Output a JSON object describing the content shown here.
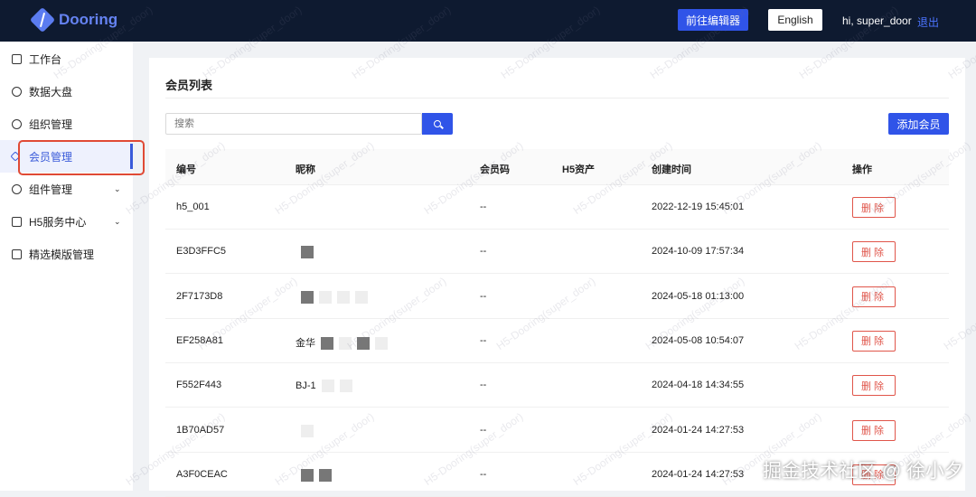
{
  "header": {
    "logo": "Dooring",
    "editor_button": "前往编辑器",
    "lang_button": "English",
    "user": "hi, super_door",
    "logout": "退出"
  },
  "sidebar": {
    "items": [
      {
        "label": "工作台"
      },
      {
        "label": "数据大盘"
      },
      {
        "label": "组织管理"
      },
      {
        "label": "会员管理",
        "active": true
      },
      {
        "label": "组件管理",
        "expandable": true
      },
      {
        "label": "H5服务中心",
        "expandable": true
      },
      {
        "label": "精选模版管理"
      }
    ]
  },
  "main": {
    "title": "会员列表",
    "search_placeholder": "搜索",
    "add_button": "添加会员",
    "columns": [
      "编号",
      "昵称",
      "会员码",
      "H5资产",
      "创建时间",
      "操作"
    ],
    "rows": [
      {
        "id": "h5_001",
        "nickname": "",
        "code": "--",
        "assets": "",
        "created": "2022-12-19 15:45:01",
        "action": "删除"
      },
      {
        "id": "E3D3FFC5",
        "nickname": "",
        "code": "--",
        "assets": "",
        "created": "2024-10-09 17:57:34",
        "action": "删除"
      },
      {
        "id": "2F7173D8",
        "nickname": "",
        "code": "--",
        "assets": "",
        "created": "2024-05-18 01:13:00",
        "action": "删除"
      },
      {
        "id": "EF258A81",
        "nickname": "金华",
        "code": "--",
        "assets": "",
        "created": "2024-05-08 10:54:07",
        "action": "删除"
      },
      {
        "id": "F552F443",
        "nickname": "BJ-1",
        "code": "--",
        "assets": "",
        "created": "2024-04-18 14:34:55",
        "action": "删除"
      },
      {
        "id": "1B70AD57",
        "nickname": "",
        "code": "--",
        "assets": "",
        "created": "2024-01-24 14:27:53",
        "action": "删除"
      },
      {
        "id": "A3F0CEAC",
        "nickname": "",
        "code": "--",
        "assets": "",
        "created": "2024-01-24 14:27:53",
        "action": "删除"
      }
    ]
  },
  "watermark": "H5-Dooring(super_door)",
  "credit": "掘金技术社区 @ 徐小夕"
}
